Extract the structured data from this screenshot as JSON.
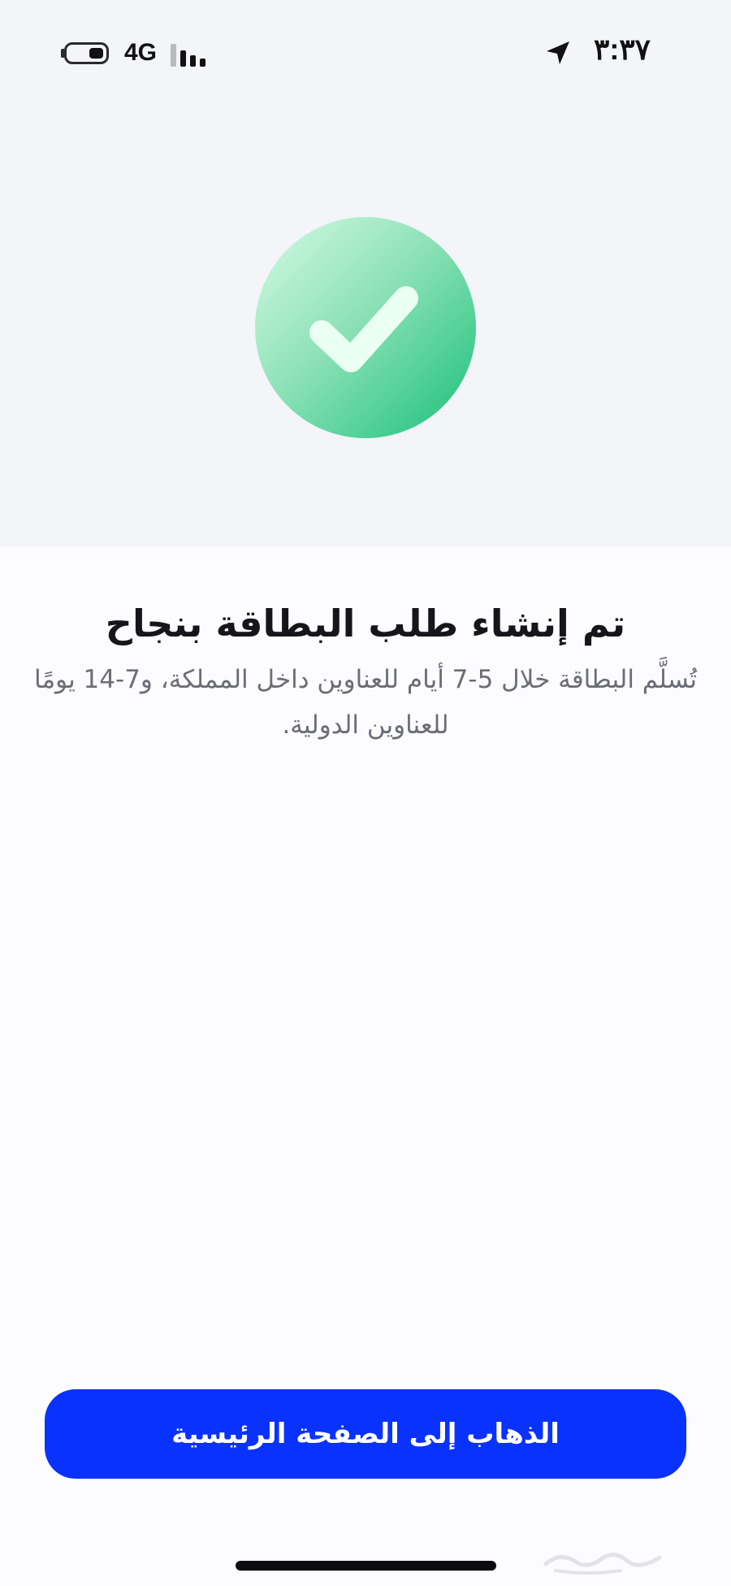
{
  "status_bar": {
    "time": "٣:٣٧",
    "network": "4G",
    "battery_icon": "battery-icon",
    "signal_icon": "signal-bars-icon",
    "location_icon": "location-arrow-icon"
  },
  "success": {
    "icon": "checkmark-circle-icon",
    "title": "تم إنشاء طلب البطاقة بنجاح",
    "subtitle": "تُسلَّم البطاقة خلال 5-7 أيام للعناوين داخل المملكة، و7-14 يومًا للعناوين الدولية."
  },
  "actions": {
    "home_button_label": "الذهاب إلى الصفحة الرئيسية"
  },
  "colors": {
    "accent": "#0a32ff",
    "success_green": "#19c07a",
    "background_top": "#f3f5f9",
    "background": "#fcfcfe"
  }
}
